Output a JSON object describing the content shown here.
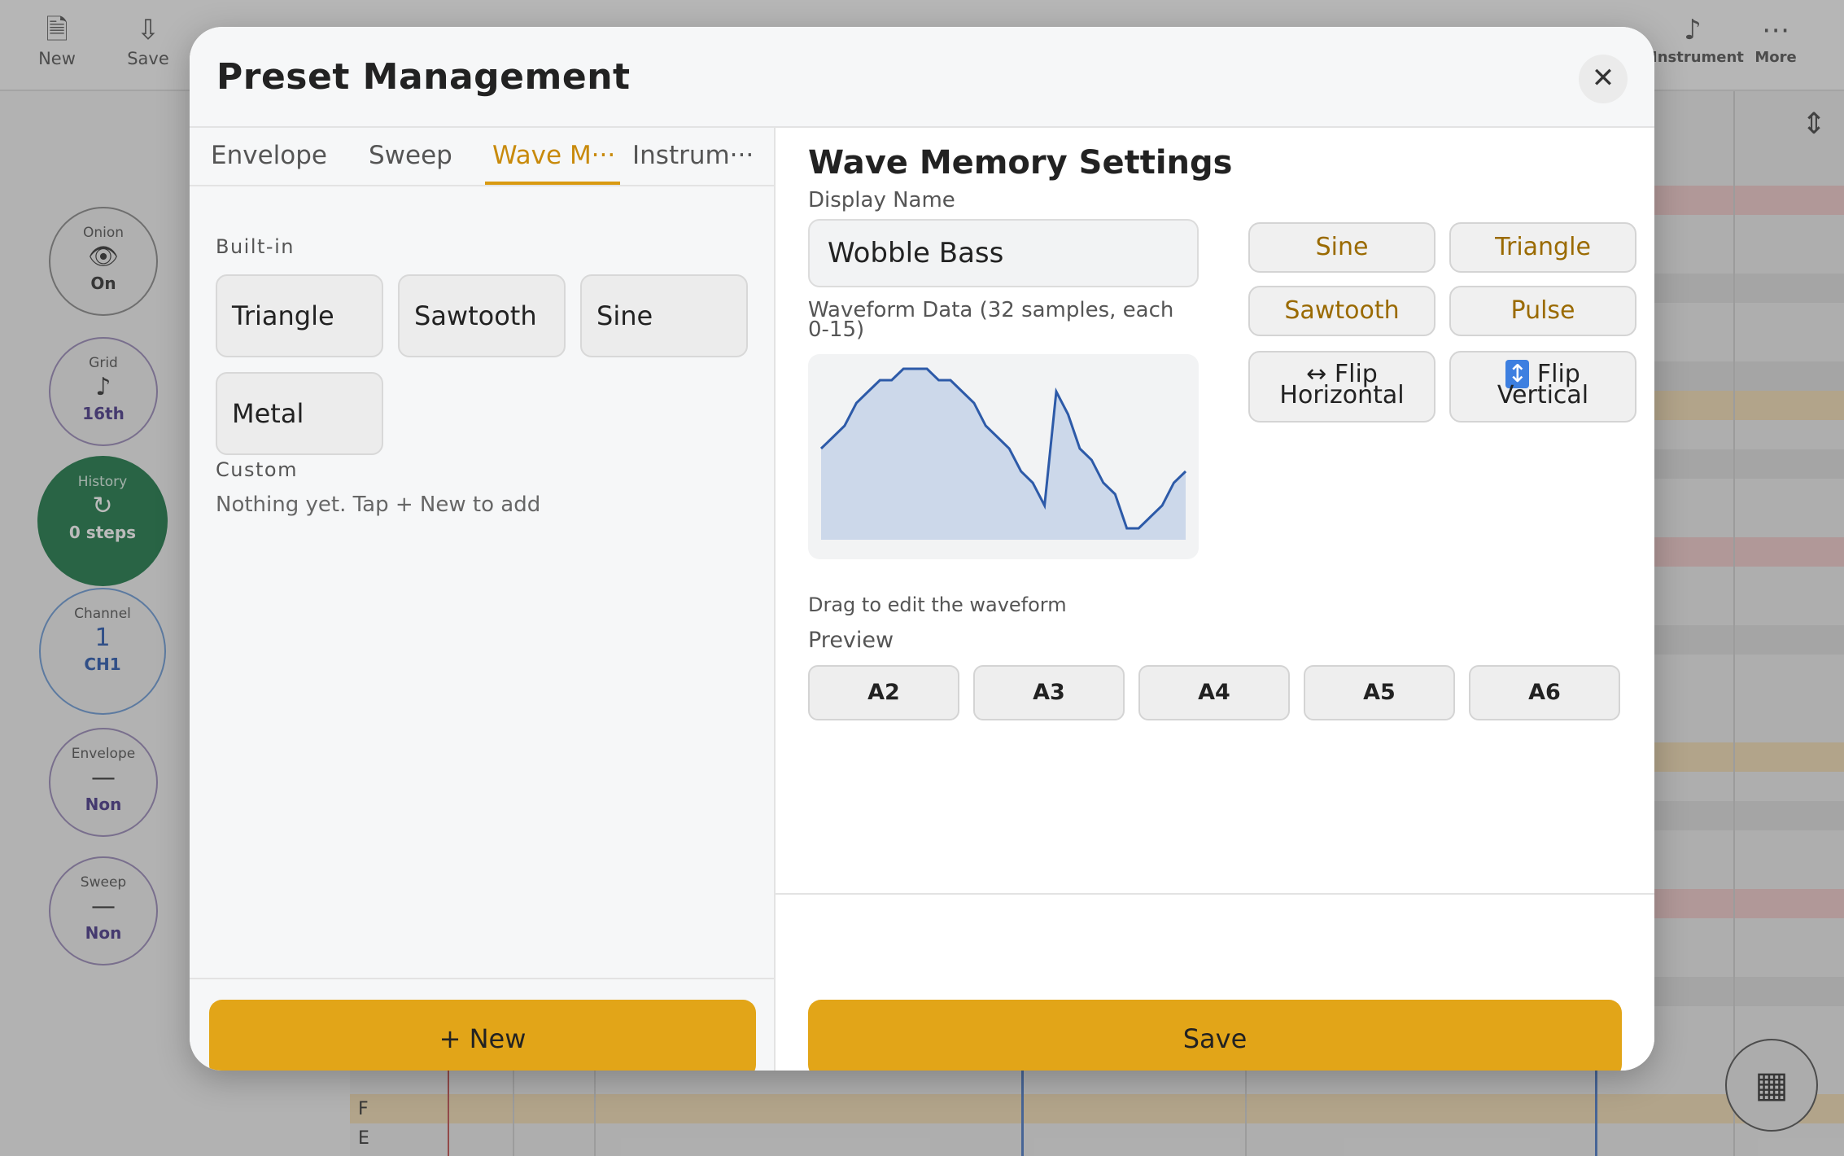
{
  "toolbar": {
    "new_label": "New",
    "save_label": "Save",
    "instrument_label": "Instrument",
    "more_label": "More"
  },
  "side": {
    "onion": {
      "title": "Onion",
      "value": "On"
    },
    "grid": {
      "title": "Grid",
      "value": "16th"
    },
    "history": {
      "title": "History",
      "value": "0 steps"
    },
    "channel": {
      "title": "Channel",
      "number": "1",
      "value": "CH1"
    },
    "envelope": {
      "title": "Envelope",
      "value": "Non"
    },
    "sweep": {
      "title": "Sweep",
      "value": "Non"
    }
  },
  "piano_keys": [
    "F",
    "E"
  ],
  "modal": {
    "title": "Preset Management",
    "close_glyph": "✕",
    "tabs": [
      "Envelope",
      "Sweep",
      "Wave M···",
      "Instrum···"
    ],
    "active_tab": 2,
    "builtin_label": "Built-in",
    "builtin_presets": [
      "Triangle",
      "Sawtooth",
      "Sine",
      "Metal"
    ],
    "custom_label": "Custom",
    "custom_empty": "Nothing yet. Tap + New to add",
    "new_button": "+ New",
    "settings_title": "Wave Memory Settings",
    "display_name_label": "Display Name",
    "display_name_value": "Wobble Bass",
    "waveform_label": "Waveform Data (32 samples, each 0-15)",
    "waveform_samples": [
      8,
      9,
      10,
      12,
      13,
      14,
      14,
      15,
      15,
      15,
      14,
      14,
      13,
      12,
      10,
      9,
      8,
      6,
      5,
      3,
      13,
      11,
      8,
      7,
      5,
      4,
      1,
      1,
      2,
      3,
      5,
      6
    ],
    "waveform_color": "#2d5aa8",
    "waveform_fill": "#ccd8ea",
    "drag_hint": "Drag to edit the waveform",
    "preview_label": "Preview",
    "preview_notes": [
      "A2",
      "A3",
      "A4",
      "A5",
      "A6"
    ],
    "shape_buttons": [
      "Sine",
      "Triangle",
      "Sawtooth",
      "Pulse"
    ],
    "flip_horizontal": {
      "icon": "↔",
      "line1": "Flip",
      "line2": "Horizontal"
    },
    "flip_vertical": {
      "icon": "↕",
      "line1": "Flip",
      "line2": "Vertical"
    },
    "save_button": "Save",
    "accent_color": "#e2a518"
  }
}
